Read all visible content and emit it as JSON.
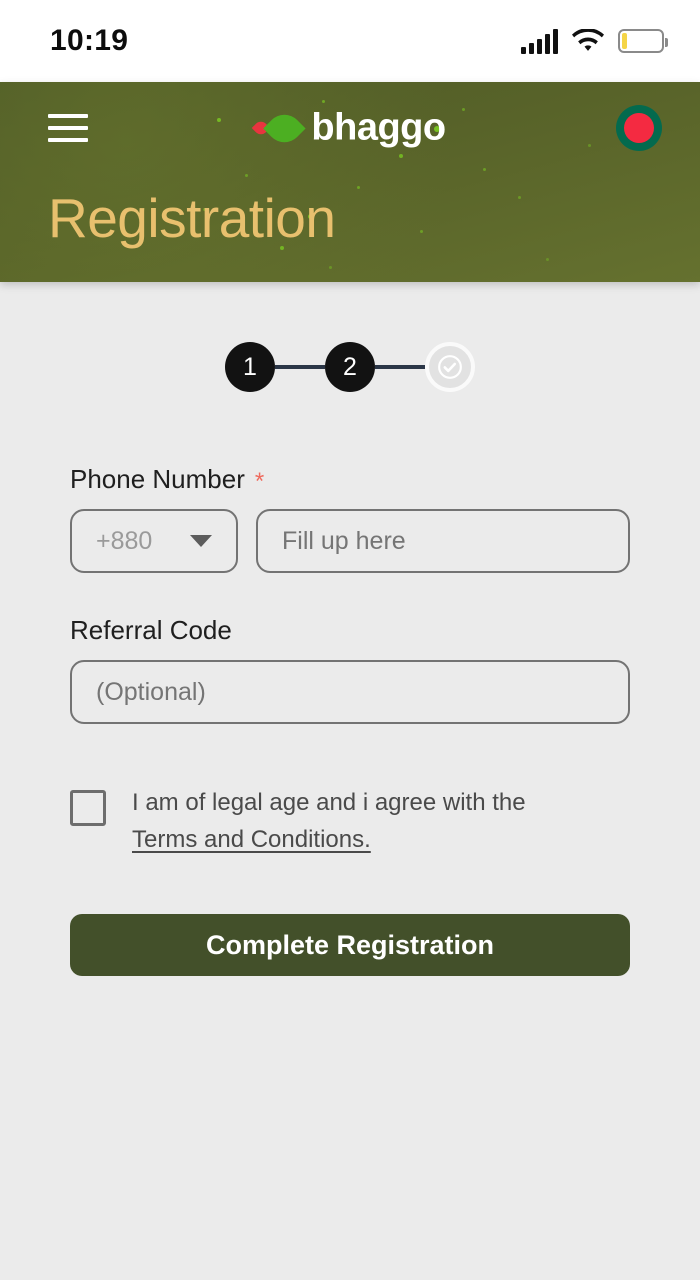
{
  "status_bar": {
    "time": "10:19",
    "signal_icon": "signal-bars-icon",
    "wifi_icon": "wifi-icon",
    "battery_icon": "battery-low-icon",
    "battery_level_percent": 12
  },
  "header": {
    "menu_icon": "hamburger-menu-icon",
    "brand_name": "bhaggo",
    "logo_icon": "bhaggo-leaf-logo-icon",
    "language_flag_icon": "bangladesh-flag-icon",
    "page_title": "Registration",
    "background_color": "#586329",
    "title_color": "#e8c06e"
  },
  "stepper": {
    "steps": [
      {
        "label": "1",
        "state": "done"
      },
      {
        "label": "2",
        "state": "done"
      },
      {
        "label": "",
        "state": "pending",
        "icon": "check-circle-icon"
      }
    ],
    "active_color": "#121212",
    "line_color": "#2b3647",
    "pending_color": "#e2e2e2"
  },
  "form": {
    "phone": {
      "label": "Phone Number",
      "required_marker": "*",
      "required_color": "#ef6b5e",
      "country_code_value": "+880",
      "country_code_icon": "chevron-down-icon",
      "number_placeholder": "Fill up here",
      "number_value": ""
    },
    "referral": {
      "label": "Referral Code",
      "placeholder": "(Optional)",
      "value": ""
    },
    "terms": {
      "checked": false,
      "text": "I am of legal age and i agree with the",
      "link_text": "Terms and Conditions."
    },
    "submit_label": "Complete Registration",
    "submit_color": "#43502a"
  }
}
